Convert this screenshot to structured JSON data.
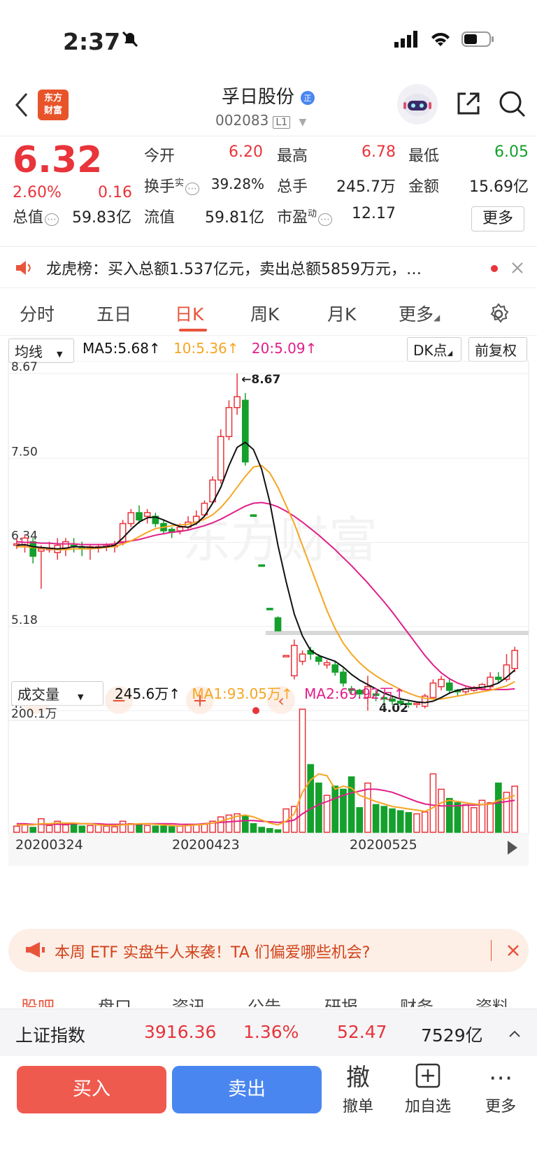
{
  "status_bar": {
    "time": "2:37"
  },
  "header": {
    "logo_line1": "东方",
    "logo_line2": "财富",
    "stock_name": "孚日股份",
    "stock_code": "002083",
    "level_badge": "L1"
  },
  "quote": {
    "price": "6.32",
    "change_pct": "2.60%",
    "change": "0.16",
    "open_label": "今开",
    "open": "6.20",
    "high_label": "最高",
    "high": "6.78",
    "low_label": "最低",
    "low": "6.05",
    "turnover_label": "换手",
    "turnover_sup": "实",
    "turnover": "39.28%",
    "volume_label": "总手",
    "volume": "245.7万",
    "amount_label": "金额",
    "amount": "15.69亿",
    "mktcap_label": "总值",
    "mktcap": "59.83亿",
    "float_label": "流值",
    "float": "59.81亿",
    "pe_label": "市盈",
    "pe_sup": "动",
    "pe": "12.17",
    "more": "更多"
  },
  "notice": {
    "text": "龙虎榜：买入总额1.537亿元，卖出总额5859万元，…"
  },
  "tabs": [
    "分时",
    "五日",
    "日K",
    "周K",
    "月K",
    "更多"
  ],
  "chart_controls": {
    "indicator": "均线",
    "ma5": "MA5:5.68↑",
    "ma10": "10:5.36↑",
    "ma20": "20:5.09↑",
    "dk": "DK点",
    "adjust": "前复权",
    "vol_indicator": "成交量",
    "vol": "245.6万↑",
    "vol_ma1": "MA1:93.05万↑",
    "vol_ma2": "MA2:69.92万↑"
  },
  "chart_data": {
    "type": "candlestick",
    "price_ticks": [
      "8.67",
      "7.50",
      "6.34",
      "5.18",
      "4.02"
    ],
    "ylim": [
      4.02,
      8.67
    ],
    "max_label": "8.67",
    "min_label": "4.02",
    "x_tick_labels": [
      "20200324",
      "20200423",
      "20200525"
    ],
    "volume_top_label": "200.1万",
    "candles": [
      {
        "o": 6.3,
        "c": 6.32,
        "h": 6.4,
        "l": 6.25
      },
      {
        "o": 6.3,
        "c": 6.4,
        "h": 6.45,
        "l": 6.2
      },
      {
        "o": 6.35,
        "c": 6.15,
        "h": 6.4,
        "l": 6.05
      },
      {
        "o": 6.22,
        "c": 6.25,
        "h": 6.3,
        "l": 5.7
      },
      {
        "o": 6.24,
        "c": 6.26,
        "h": 6.35,
        "l": 6.2
      },
      {
        "o": 6.2,
        "c": 6.3,
        "h": 6.4,
        "l": 6.1
      },
      {
        "o": 6.25,
        "c": 6.35,
        "h": 6.4,
        "l": 6.15
      },
      {
        "o": 6.3,
        "c": 6.28,
        "h": 6.4,
        "l": 6.2
      },
      {
        "o": 6.28,
        "c": 6.25,
        "h": 6.35,
        "l": 6.15
      },
      {
        "o": 6.25,
        "c": 6.28,
        "h": 6.3,
        "l": 6.1
      },
      {
        "o": 6.26,
        "c": 6.28,
        "h": 6.32,
        "l": 6.2
      },
      {
        "o": 6.28,
        "c": 6.3,
        "h": 6.33,
        "l": 6.22
      },
      {
        "o": 6.28,
        "c": 6.3,
        "h": 6.36,
        "l": 6.2
      },
      {
        "o": 6.35,
        "c": 6.6,
        "h": 6.65,
        "l": 6.3
      },
      {
        "o": 6.6,
        "c": 6.75,
        "h": 6.8,
        "l": 6.55
      },
      {
        "o": 6.75,
        "c": 6.65,
        "h": 6.85,
        "l": 6.6
      },
      {
        "o": 6.7,
        "c": 6.75,
        "h": 6.8,
        "l": 6.6
      },
      {
        "o": 6.7,
        "c": 6.6,
        "h": 6.75,
        "l": 6.55
      },
      {
        "o": 6.6,
        "c": 6.5,
        "h": 6.65,
        "l": 6.45
      },
      {
        "o": 6.52,
        "c": 6.48,
        "h": 6.55,
        "l": 6.4
      },
      {
        "o": 6.5,
        "c": 6.55,
        "h": 6.6,
        "l": 6.45
      },
      {
        "o": 6.55,
        "c": 6.62,
        "h": 6.7,
        "l": 6.5
      },
      {
        "o": 6.62,
        "c": 6.7,
        "h": 6.78,
        "l": 6.58
      },
      {
        "o": 6.72,
        "c": 6.88,
        "h": 6.92,
        "l": 6.7
      },
      {
        "o": 6.9,
        "c": 7.2,
        "h": 7.25,
        "l": 6.88
      },
      {
        "o": 7.2,
        "c": 7.8,
        "h": 7.9,
        "l": 7.15
      },
      {
        "o": 7.8,
        "c": 8.2,
        "h": 8.3,
        "l": 7.75
      },
      {
        "o": 8.2,
        "c": 8.35,
        "h": 8.67,
        "l": 8.1
      },
      {
        "o": 8.3,
        "c": 7.45,
        "h": 8.4,
        "l": 7.4
      },
      {
        "o": 6.72,
        "c": 6.7,
        "h": 6.72,
        "l": 6.7
      },
      {
        "o": 6.03,
        "c": 6.02,
        "h": 6.03,
        "l": 6.02
      },
      {
        "o": 5.43,
        "c": 5.42,
        "h": 5.43,
        "l": 5.42
      },
      {
        "o": 5.3,
        "c": 5.12,
        "h": 5.32,
        "l": 5.12
      },
      {
        "o": 4.78,
        "c": 4.78,
        "h": 4.78,
        "l": 4.78
      },
      {
        "o": 4.5,
        "c": 4.92,
        "h": 5.0,
        "l": 4.45
      },
      {
        "o": 4.7,
        "c": 4.8,
        "h": 4.85,
        "l": 4.65
      },
      {
        "o": 4.85,
        "c": 4.8,
        "h": 4.9,
        "l": 4.72
      },
      {
        "o": 4.76,
        "c": 4.7,
        "h": 4.8,
        "l": 4.65
      },
      {
        "o": 4.65,
        "c": 4.68,
        "h": 4.72,
        "l": 4.6
      },
      {
        "o": 4.65,
        "c": 4.55,
        "h": 4.7,
        "l": 4.5
      },
      {
        "o": 4.55,
        "c": 4.4,
        "h": 4.6,
        "l": 4.35
      },
      {
        "o": 4.32,
        "c": 4.3,
        "h": 4.36,
        "l": 4.25
      },
      {
        "o": 4.3,
        "c": 4.25,
        "h": 4.32,
        "l": 4.2
      },
      {
        "o": 4.2,
        "c": 4.35,
        "h": 4.5,
        "l": 4.02
      },
      {
        "o": 4.25,
        "c": 4.23,
        "h": 4.3,
        "l": 4.15
      },
      {
        "o": 4.2,
        "c": 4.18,
        "h": 4.25,
        "l": 4.12
      },
      {
        "o": 4.18,
        "c": 4.15,
        "h": 4.22,
        "l": 4.1
      },
      {
        "o": 4.15,
        "c": 4.12,
        "h": 4.2,
        "l": 4.08
      },
      {
        "o": 4.12,
        "c": 4.1,
        "h": 4.15,
        "l": 4.06
      },
      {
        "o": 4.1,
        "c": 4.12,
        "h": 4.14,
        "l": 4.06
      },
      {
        "o": 4.08,
        "c": 4.22,
        "h": 4.25,
        "l": 4.05
      },
      {
        "o": 4.2,
        "c": 4.4,
        "h": 4.45,
        "l": 4.18
      },
      {
        "o": 4.35,
        "c": 4.45,
        "h": 4.5,
        "l": 4.3
      },
      {
        "o": 4.4,
        "c": 4.3,
        "h": 4.45,
        "l": 4.25
      },
      {
        "o": 4.3,
        "c": 4.28,
        "h": 4.32,
        "l": 4.22
      },
      {
        "o": 4.28,
        "c": 4.32,
        "h": 4.35,
        "l": 4.24
      },
      {
        "o": 4.3,
        "c": 4.34,
        "h": 4.36,
        "l": 4.28
      },
      {
        "o": 4.32,
        "c": 4.38,
        "h": 4.4,
        "l": 4.3
      },
      {
        "o": 4.35,
        "c": 4.48,
        "h": 4.55,
        "l": 4.32
      },
      {
        "o": 4.48,
        "c": 4.45,
        "h": 4.55,
        "l": 4.4
      },
      {
        "o": 4.45,
        "c": 4.65,
        "h": 4.8,
        "l": 4.42
      },
      {
        "o": 4.6,
        "c": 4.85,
        "h": 4.9,
        "l": 4.55
      }
    ],
    "ma5": [
      6.3,
      6.31,
      6.28,
      6.27,
      6.26,
      6.25,
      6.26,
      6.28,
      6.28,
      6.27,
      6.27,
      6.28,
      6.3,
      6.4,
      6.52,
      6.62,
      6.68,
      6.69,
      6.65,
      6.6,
      6.56,
      6.55,
      6.6,
      6.7,
      6.88,
      7.1,
      7.4,
      7.65,
      7.72,
      7.62,
      7.35,
      6.9,
      6.3,
      5.8,
      5.35,
      5.05,
      4.85,
      4.78,
      4.74,
      4.7,
      4.62,
      4.52,
      4.44,
      4.38,
      4.32,
      4.26,
      4.22,
      4.18,
      4.16,
      4.14,
      4.13,
      4.15,
      4.2,
      4.26,
      4.3,
      4.32,
      4.33,
      4.34,
      4.36,
      4.4,
      4.48,
      4.58
    ],
    "ma10": [
      6.28,
      6.28,
      6.27,
      6.26,
      6.25,
      6.24,
      6.24,
      6.25,
      6.25,
      6.25,
      6.26,
      6.27,
      6.28,
      6.32,
      6.36,
      6.42,
      6.48,
      6.53,
      6.55,
      6.57,
      6.58,
      6.59,
      6.62,
      6.66,
      6.72,
      6.82,
      6.95,
      7.1,
      7.25,
      7.38,
      7.4,
      7.3,
      7.1,
      6.85,
      6.6,
      6.3,
      6.0,
      5.7,
      5.4,
      5.15,
      4.95,
      4.8,
      4.68,
      4.58,
      4.5,
      4.43,
      4.37,
      4.31,
      4.26,
      4.22,
      4.19,
      4.18,
      4.18,
      4.2,
      4.22,
      4.24,
      4.26,
      4.28,
      4.3,
      4.33,
      4.36,
      4.42
    ],
    "ma20": [
      6.35,
      6.34,
      6.34,
      6.33,
      6.33,
      6.32,
      6.32,
      6.32,
      6.31,
      6.31,
      6.31,
      6.31,
      6.32,
      6.34,
      6.36,
      6.38,
      6.41,
      6.44,
      6.46,
      6.48,
      6.49,
      6.51,
      6.54,
      6.57,
      6.61,
      6.66,
      6.72,
      6.78,
      6.84,
      6.88,
      6.89,
      6.87,
      6.83,
      6.77,
      6.7,
      6.62,
      6.53,
      6.44,
      6.34,
      6.24,
      6.13,
      6.02,
      5.9,
      5.78,
      5.65,
      5.52,
      5.38,
      5.23,
      5.08,
      4.93,
      4.78,
      4.65,
      4.54,
      4.46,
      4.4,
      4.36,
      4.33,
      4.31,
      4.31,
      4.31,
      4.31,
      4.32
    ],
    "volume": [
      10,
      12,
      8,
      22,
      11,
      18,
      12,
      13,
      10,
      11,
      12,
      10,
      9,
      18,
      14,
      12,
      11,
      10,
      10,
      9,
      10,
      11,
      12,
      13,
      18,
      25,
      28,
      30,
      26,
      14,
      8,
      6,
      4,
      38,
      42,
      200.1,
      110,
      80,
      60,
      75,
      70,
      90,
      40,
      80,
      45,
      42,
      38,
      35,
      32,
      30,
      33,
      95,
      70,
      55,
      48,
      45,
      40,
      52,
      48,
      80,
      65,
      75
    ],
    "vol_ma1": [
      12,
      12,
      12,
      14,
      14,
      15,
      15,
      15,
      14,
      14,
      12,
      11,
      11,
      12,
      13,
      14,
      14,
      13,
      12,
      11,
      10,
      11,
      12,
      13,
      15,
      18,
      22,
      26,
      28,
      25,
      20,
      15,
      12,
      18,
      30,
      65,
      85,
      95,
      92,
      70,
      75,
      72,
      60,
      55,
      50,
      46,
      42,
      40,
      38,
      36,
      34,
      40,
      48,
      52,
      50,
      48,
      46,
      45,
      46,
      52,
      55,
      60
    ],
    "vol_ma2": [
      14,
      14,
      13,
      13,
      13,
      13,
      13,
      14,
      14,
      14,
      14,
      13,
      13,
      13,
      13,
      13,
      14,
      14,
      14,
      14,
      13,
      13,
      13,
      14,
      15,
      16,
      17,
      18,
      19,
      19,
      18,
      17,
      16,
      17,
      20,
      30,
      38,
      45,
      50,
      55,
      60,
      64,
      67,
      70,
      70,
      68,
      65,
      60,
      55,
      50,
      46,
      44,
      43,
      43,
      43,
      44,
      44,
      45,
      46,
      48,
      50,
      52
    ]
  },
  "banner": {
    "text": "本周 ETF 实盘牛人来袭！TA 们偏爱哪些机会?"
  },
  "subtabs": [
    "股吧",
    "盘口",
    "资讯",
    "公告",
    "研报",
    "财务",
    "资料"
  ],
  "index_bar": {
    "name": "上证指数",
    "value": "3916.36",
    "pct": "1.36%",
    "change": "52.47",
    "amount": "7529亿"
  },
  "bottom_bar": {
    "buy": "买入",
    "sell": "卖出",
    "cancel": "撤单",
    "cancel_glyph": "撤",
    "add": "加自选",
    "more": "更多"
  },
  "colors": {
    "up": "#e8343a",
    "down": "#14a02c",
    "ma5": "#111111",
    "ma10": "#f5a623",
    "ma20": "#e0208a",
    "brand": "#e8543a"
  }
}
